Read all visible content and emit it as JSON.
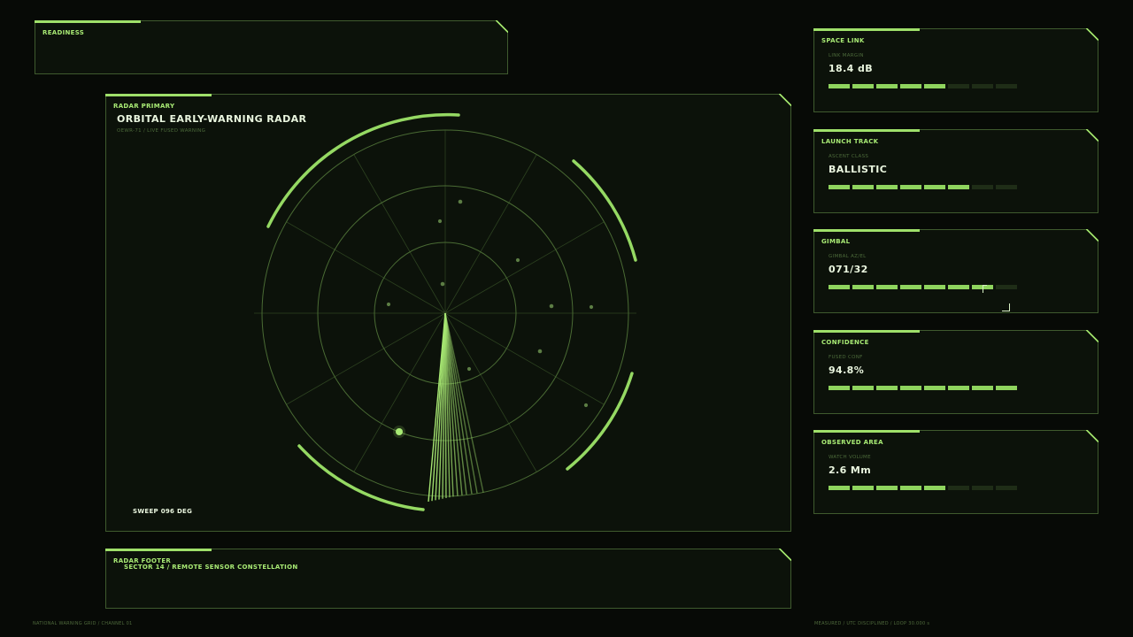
{
  "readiness": {
    "title": "READINESS"
  },
  "radar": {
    "panel_title": "RADAR PRIMARY",
    "heading": "ORBITAL EARLY-WARNING RADAR",
    "subheading": "OEWR-71 / LIVE FUSED WARNING",
    "sweep_label": "SWEEP 096 DEG",
    "sweep_deg": 96
  },
  "footer": {
    "panel_title": "RADAR FOOTER",
    "text": "SECTOR 14 / REMOTE SENSOR CONSTELLATION"
  },
  "metrics": [
    {
      "title": "SPACE LINK",
      "label": "LINK MARGIN",
      "value": "18.4 dB",
      "level": 5,
      "of": 8
    },
    {
      "title": "LAUNCH TRACK",
      "label": "ASCENT CLASS",
      "value": "BALLISTIC",
      "level": 6,
      "of": 8
    },
    {
      "title": "GIMBAL",
      "label": "GIMBAL AZ/EL",
      "value": "071/32",
      "level": 7,
      "of": 8
    },
    {
      "title": "CONFIDENCE",
      "label": "FUSED CONF",
      "value": "94.8%",
      "level": 8,
      "of": 8
    },
    {
      "title": "OBSERVED AREA",
      "label": "WATCH VOLUME",
      "value": "2.6 Mm",
      "level": 5,
      "of": 8
    }
  ],
  "bottom_left": "NATIONAL WARNING GRID / CHANNEL 01",
  "bottom_right": "MEASURED / UTC DISCIPLINED / LOOP 30.000 s",
  "colors": {
    "accent": "#9fe06a",
    "background": "#070a06",
    "panel": "#0c120a",
    "border": "#3f5a2e"
  }
}
